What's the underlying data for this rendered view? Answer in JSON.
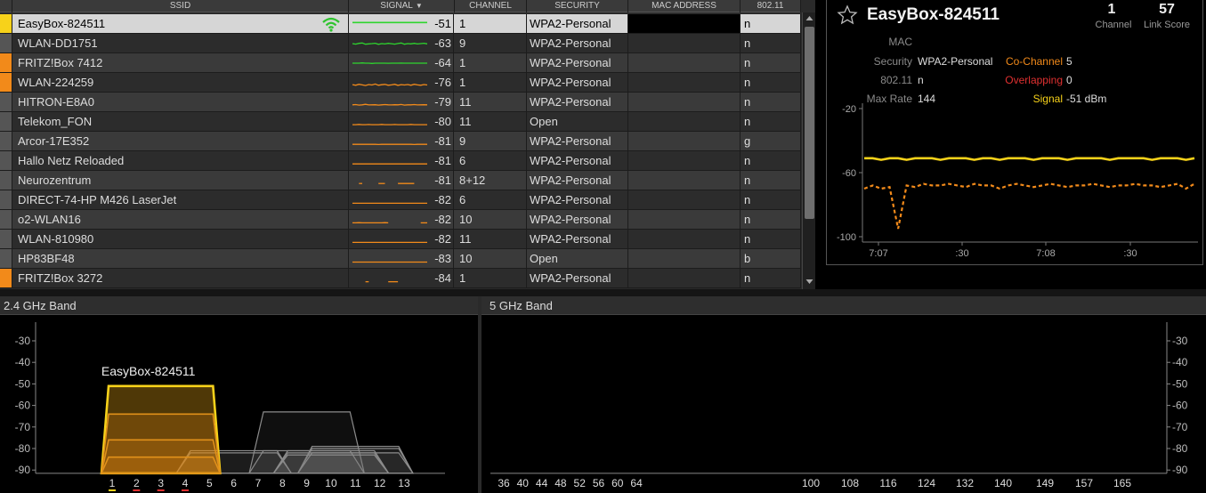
{
  "table": {
    "headers": {
      "ssid": "SSID",
      "signal": "SIGNAL",
      "channel": "CHANNEL",
      "security": "SECURITY",
      "mac": "MAC ADDRESS",
      "proto": "802.11"
    },
    "sort_column": "signal",
    "rows": [
      {
        "color": "#f7d21a",
        "ssid": "EasyBox-824511",
        "signal": "-51",
        "channel": "1",
        "security": "WPA2-Personal",
        "proto": "n",
        "spark_color": "#2ed52e",
        "selected": true,
        "spark": [
          0.62,
          0.62,
          0.62,
          0.62,
          0.62,
          0.62,
          0.62,
          0.62,
          0.62,
          0.62,
          0.62,
          0.62,
          0.62,
          0.62,
          0.62,
          0.62,
          0.62,
          0.62,
          0.62,
          0.62,
          0.62,
          0.62,
          0.62,
          0.62
        ]
      },
      {
        "color": "#555555",
        "ssid": "WLAN-DD1751",
        "signal": "-63",
        "channel": "9",
        "security": "WPA2-Personal",
        "proto": "n",
        "spark_color": "#2ed52e",
        "spark": [
          0.5,
          0.46,
          0.52,
          0.55,
          0.45,
          0.48,
          0.5,
          0.53,
          0.44,
          0.5,
          0.47,
          0.52,
          0.49,
          0.46,
          0.51,
          0.55,
          0.45,
          0.5,
          0.48,
          0.52,
          0.47,
          0.5,
          0.53,
          0.48
        ]
      },
      {
        "color": "#f28a1a",
        "ssid": "FRITZ!Box 7412",
        "signal": "-64",
        "channel": "1",
        "security": "WPA2-Personal",
        "proto": "n",
        "spark_color": "#2ed52e",
        "spark": [
          0.5,
          0.5,
          0.5,
          0.52,
          0.5,
          0.5,
          0.48,
          0.5,
          0.5,
          0.5,
          0.5,
          0.49,
          0.5,
          0.5,
          0.5,
          0.51,
          0.5,
          0.5,
          0.5,
          0.5,
          0.5,
          0.5,
          0.5,
          0.5
        ]
      },
      {
        "color": "#f28a1a",
        "ssid": "WLAN-224259",
        "signal": "-76",
        "channel": "1",
        "security": "WPA2-Personal",
        "proto": "n",
        "spark_color": "#f28a1a",
        "spark": [
          0.35,
          0.3,
          0.38,
          0.33,
          0.28,
          0.36,
          0.32,
          0.4,
          0.3,
          0.34,
          0.37,
          0.3,
          0.33,
          0.38,
          0.29,
          0.35,
          0.32,
          0.36,
          0.3,
          0.38,
          0.33,
          0.3,
          0.36,
          0.32
        ]
      },
      {
        "color": "#555555",
        "ssid": "HITRON-E8A0",
        "signal": "-79",
        "channel": "11",
        "security": "WPA2-Personal",
        "proto": "n",
        "spark_color": "#f28a1a",
        "spark": [
          0.3,
          0.32,
          0.28,
          0.3,
          0.34,
          0.29,
          0.3,
          0.31,
          0.28,
          0.3,
          0.32,
          0.3,
          0.29,
          0.31,
          0.3,
          0.33,
          0.28,
          0.3,
          0.3,
          0.32,
          0.29,
          0.3,
          0.31,
          0.3
        ]
      },
      {
        "color": "#555555",
        "ssid": "Telekom_FON",
        "signal": "-80",
        "channel": "11",
        "security": "Open",
        "proto": "n",
        "spark_color": "#f28a1a",
        "spark": [
          0.28,
          0.28,
          0.3,
          0.28,
          0.28,
          0.29,
          0.28,
          0.28,
          0.28,
          0.3,
          0.28,
          0.28,
          0.28,
          0.29,
          0.28,
          0.28,
          0.28,
          0.28,
          0.3,
          0.28,
          0.28,
          0.28,
          0.28,
          0.28
        ]
      },
      {
        "color": "#555555",
        "ssid": "Arcor-17E352",
        "signal": "-81",
        "channel": "9",
        "security": "WPA2-Personal",
        "proto": "g",
        "spark_color": "#f28a1a",
        "spark": [
          0.27,
          0.27,
          0.27,
          0.28,
          0.27,
          0.27,
          0.27,
          0.27,
          0.26,
          0.27,
          0.27,
          0.27,
          0.28,
          0.27,
          0.27,
          0.27,
          0.27,
          0.27,
          0.27,
          0.26,
          0.27,
          0.27,
          0.27,
          0.27
        ]
      },
      {
        "color": "#555555",
        "ssid": "Hallo Netz Reloaded",
        "signal": "-81",
        "channel": "6",
        "security": "WPA2-Personal",
        "proto": "n",
        "spark_color": "#f28a1a",
        "spark": [
          0.27,
          0.27,
          0.27,
          0.27,
          0.27,
          0.27,
          0.27,
          0.27,
          0.27,
          0.27,
          0.27,
          0.27,
          0.27,
          0.27,
          0.27,
          0.27,
          0.27,
          0.27,
          0.27,
          0.27,
          0.27,
          0.27,
          0.27,
          0.27
        ]
      },
      {
        "color": "#555555",
        "ssid": "Neurozentrum",
        "signal": "-81",
        "channel": "8+12",
        "security": "WPA2-Personal",
        "proto": "n",
        "spark_color": "#f28a1a",
        "spark": [
          null,
          null,
          0.27,
          0.27,
          null,
          null,
          null,
          null,
          0.27,
          0.27,
          0.27,
          null,
          null,
          null,
          0.27,
          0.27,
          0.27,
          0.27,
          0.27,
          0.27,
          null,
          null,
          null,
          null
        ]
      },
      {
        "color": "#555555",
        "ssid": "DIRECT-74-HP M426 LaserJet",
        "signal": "-82",
        "channel": "6",
        "security": "WPA2-Personal",
        "proto": "n",
        "spark_color": "#f28a1a",
        "spark": [
          0.26,
          0.26,
          0.26,
          0.26,
          0.26,
          0.26,
          0.26,
          0.26,
          0.26,
          0.26,
          0.26,
          0.26,
          0.26,
          0.26,
          0.26,
          0.26,
          0.26,
          0.26,
          0.26,
          0.26,
          0.26,
          0.26,
          0.26,
          0.26
        ]
      },
      {
        "color": "#555555",
        "ssid": "o2-WLAN16",
        "signal": "-82",
        "channel": "10",
        "security": "WPA2-Personal",
        "proto": "n",
        "spark_color": "#f28a1a",
        "spark": [
          0.26,
          0.26,
          0.27,
          0.26,
          0.26,
          0.26,
          0.26,
          0.26,
          0.26,
          0.26,
          0.27,
          0.26,
          null,
          null,
          null,
          null,
          null,
          null,
          null,
          0.26,
          null,
          0.26,
          0.26,
          0.26
        ]
      },
      {
        "color": "#555555",
        "ssid": "WLAN-810980",
        "signal": "-82",
        "channel": "11",
        "security": "WPA2-Personal",
        "proto": "n",
        "spark_color": "#f28a1a",
        "spark": [
          0.26,
          0.26,
          0.26,
          0.26,
          0.26,
          0.26,
          0.26,
          0.26,
          0.26,
          0.26,
          0.26,
          0.26,
          0.26,
          0.26,
          0.26,
          0.26,
          0.26,
          0.26,
          0.26,
          0.26,
          0.26,
          0.26,
          0.26,
          0.26
        ]
      },
      {
        "color": "#555555",
        "ssid": "HP83BF48",
        "signal": "-83",
        "channel": "10",
        "security": "Open",
        "proto": "b",
        "spark_color": "#f28a1a",
        "spark": [
          0.25,
          0.25,
          0.25,
          0.25,
          0.25,
          0.25,
          0.25,
          0.25,
          0.25,
          0.25,
          0.25,
          0.25,
          0.25,
          0.25,
          0.25,
          0.25,
          0.25,
          0.25,
          0.25,
          0.25,
          0.25,
          0.25,
          0.25,
          0.25
        ]
      },
      {
        "color": "#f28a1a",
        "ssid": "FRITZ!Box 3272",
        "signal": "-84",
        "channel": "1",
        "security": "WPA2-Personal",
        "proto": "n",
        "spark_color": "#f28a1a",
        "spark": [
          null,
          null,
          null,
          null,
          0.24,
          0.24,
          null,
          null,
          null,
          null,
          null,
          0.24,
          0.24,
          0.24,
          0.24,
          null,
          null,
          null,
          null,
          null,
          null,
          null,
          null,
          null
        ]
      }
    ]
  },
  "detail": {
    "ssid": "EasyBox-824511",
    "channel_value": "1",
    "channel_label": "Channel",
    "link_score_value": "57",
    "link_score_label": "Link Score",
    "mac_label": "MAC",
    "mac_value": "",
    "security_label": "Security",
    "security_value": "WPA2-Personal",
    "proto_label": "802.11",
    "proto_value": "n",
    "max_rate_label": "Max Rate",
    "max_rate_value": "144",
    "co_channel_label": "Co-Channel",
    "co_channel_value": "5",
    "overlapping_label": "Overlapping",
    "overlapping_value": "0",
    "signal_label": "Signal",
    "signal_value": "-51 dBm",
    "colors": {
      "co_channel": "#f28a1a",
      "overlapping": "#e03030",
      "signal": "#f7d21a"
    },
    "history": {
      "y_ticks": [
        "-20",
        "-60",
        "-100"
      ],
      "x_ticks": [
        "7:07",
        ":30",
        "7:08",
        ":30"
      ],
      "selected_series": [
        -51,
        -51,
        -52,
        -51,
        -51,
        -52,
        -51,
        -51,
        -51,
        -52,
        -51,
        -51,
        -51,
        -52,
        -51,
        -51,
        -52,
        -51,
        -51,
        -51,
        -52,
        -51,
        -51,
        -51,
        -52,
        -51,
        -51,
        -51,
        -51,
        -52,
        -51,
        -51,
        -51,
        -51,
        -52,
        -51,
        -51,
        -51,
        -52,
        -51
      ],
      "other_series": [
        -70,
        -68,
        -70,
        -69,
        -95,
        -68,
        -69,
        -67,
        -68,
        -68,
        -67,
        -68,
        -69,
        -67,
        -68,
        -68,
        -70,
        -68,
        -67,
        -68,
        -69,
        -68,
        -67,
        -68,
        -69,
        -68,
        -68,
        -67,
        -68,
        -69,
        -68,
        -68,
        -67,
        -68,
        -68,
        -69,
        -68,
        -67,
        -70,
        -67
      ]
    }
  },
  "band24": {
    "title": "2.4 GHz Band",
    "y_ticks": [
      "-30",
      "-40",
      "-50",
      "-60",
      "-70",
      "-80",
      "-90"
    ],
    "channels": [
      "1",
      "2",
      "3",
      "4",
      "5",
      "6",
      "7",
      "8",
      "9",
      "10",
      "11",
      "12",
      "13"
    ],
    "channel_marks": {
      "1": "#f7d21a",
      "2": "#e03030",
      "3": "#e03030",
      "4": "#e03030"
    },
    "highlight_label": "EasyBox-824511",
    "networks": [
      {
        "center": 3,
        "level": -51,
        "highlight": true
      },
      {
        "center": 3,
        "level": -64,
        "highlight": true
      },
      {
        "center": 3,
        "level": -76,
        "highlight": true
      },
      {
        "center": 3,
        "level": -84,
        "highlight": true
      },
      {
        "center": 9,
        "level": -63
      },
      {
        "center": 11,
        "level": -79
      },
      {
        "center": 11,
        "level": -80
      },
      {
        "center": 9,
        "level": -81
      },
      {
        "center": 6,
        "level": -81
      },
      {
        "center": 10,
        "level": -81
      },
      {
        "center": 6,
        "level": -82
      },
      {
        "center": 10,
        "level": -82
      },
      {
        "center": 11,
        "level": -82
      },
      {
        "center": 10,
        "level": -83
      }
    ]
  },
  "band5": {
    "title": "5 GHz Band",
    "y_ticks": [
      "-30",
      "-40",
      "-50",
      "-60",
      "-70",
      "-80",
      "-90"
    ],
    "channels_low": [
      "36",
      "40",
      "44",
      "48",
      "52",
      "56",
      "60",
      "64"
    ],
    "channels_high": [
      "100",
      "108",
      "116",
      "124",
      "132",
      "140",
      "149",
      "157",
      "165"
    ]
  }
}
